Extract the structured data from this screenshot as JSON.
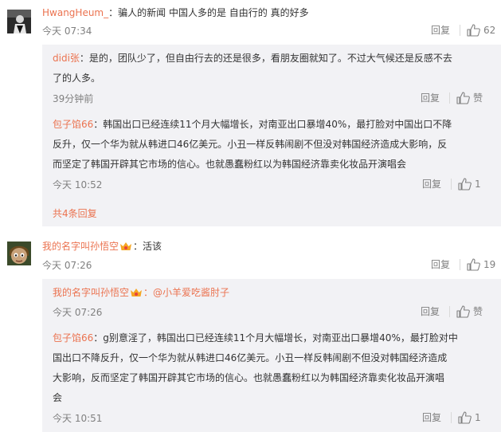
{
  "c1": {
    "user": "HwangHeum_",
    "text": "：骗人的新闻 中国人多的是 自由行的 真的好多",
    "time": "今天 07:34",
    "reply": "回复",
    "likes": "62"
  },
  "c1r1": {
    "user": "didi张",
    "text_l1": "：是的，团队少了，但自由行去的还是很多，看朋友圈就知了。不过大气候还是反感不去",
    "text_l2": "了的人多。",
    "time": "39分钟前",
    "reply": "回复",
    "likes": "赞"
  },
  "c1r2": {
    "user": "包子馅66",
    "text_l1": "：韩国出口已经连续11个月大幅增长，对南亚出口暴增40%，最打脸对中国出口不降",
    "text_l2": "反升，仅一个华为就从韩进口46亿美元。小丑一样反韩闹剧不但没对韩国经济造成大影响，反",
    "text_l3": "而坚定了韩国开辟其它市场的信心。也就愚蠢粉红以为韩国经济靠卖化妆品开演唱会",
    "time": "今天 10:52",
    "reply": "回复",
    "likes": "1"
  },
  "c1more": "共4条回复",
  "c2": {
    "user": "我的名字叫孙悟空",
    "text": "：活该",
    "time": "今天 07:26",
    "reply": "回复",
    "likes": "19"
  },
  "c2r1": {
    "user": "我的名字叫孙悟空",
    "text": "：@小羊爱吃酱肘子",
    "time": "今天 07:26",
    "reply": "回复",
    "likes": "赞"
  },
  "c2r2": {
    "user": "包子馅66",
    "text_l1": "：g别意淫了，韩国出口已经连续11个月大幅增长，对南亚出口暴增40%，最打脸对中",
    "text_l2": "国出口不降反升，仅一个华为就从韩进口46亿美元。小丑一样反韩闹剧不但没对韩国经济造成",
    "text_l3": "大影响，反而坚定了韩国开辟其它市场的信心。也就愚蠢粉红以为韩国经济靠卖化妆品开演唱",
    "text_l4": "会",
    "time": "今天 10:51",
    "reply": "回复",
    "likes": "1"
  },
  "colors": {
    "name": "#eb7350",
    "text": "#333333",
    "meta": "#808080",
    "reply_bg": "#f2f2f5"
  },
  "icons": [
    "avatar-dark-figure",
    "avatar-cartoon-face",
    "thumb-up-icon",
    "member-crown-icon"
  ]
}
